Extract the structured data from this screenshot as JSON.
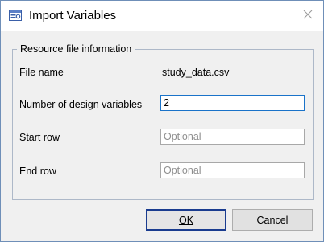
{
  "window": {
    "title": "Import Variables",
    "icon": "import-dialog-icon",
    "close_icon": "close-icon"
  },
  "group": {
    "title": "Resource file information"
  },
  "fields": {
    "file_name": {
      "label": "File name",
      "value": "study_data.csv"
    },
    "design_vars": {
      "label": "Number of design variables",
      "value": "2"
    },
    "start_row": {
      "label": "Start row",
      "placeholder": "Optional"
    },
    "end_row": {
      "label": "End row",
      "placeholder": "Optional"
    }
  },
  "buttons": {
    "ok": "OK",
    "cancel": "Cancel"
  }
}
